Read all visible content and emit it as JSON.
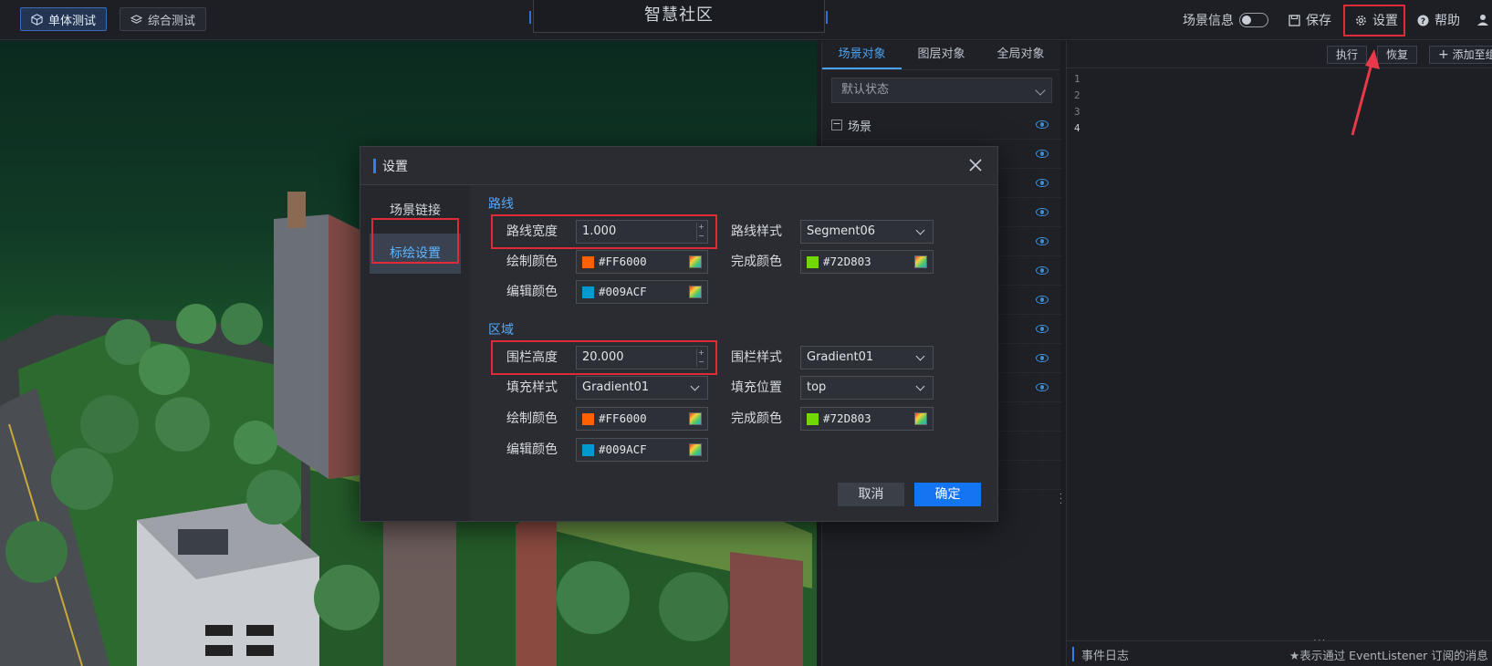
{
  "topbar": {
    "mode_single": "单体测试",
    "mode_combined": "综合测试",
    "title": "智慧社区",
    "scene_info": "场景信息",
    "save": "保存",
    "settings": "设置",
    "help": "帮助"
  },
  "object_panel": {
    "tabs": [
      "场景对象",
      "图层对象",
      "全局对象"
    ],
    "state_select": "默认状态",
    "root_node": "场景"
  },
  "code_panel": {
    "run": "执行",
    "restore": "恢复",
    "add": "添加至组",
    "line_numbers": [
      "1",
      "2",
      "3",
      "4"
    ],
    "event_log_title": "事件日志",
    "event_log_note": "★表示通过 EventListener 订阅的消息"
  },
  "modal": {
    "title": "设置",
    "sidebar": [
      "场景链接",
      "标绘设置"
    ],
    "route_section": "路线",
    "route": {
      "width_label": "路线宽度",
      "width_value": "1.000",
      "style_label": "路线样式",
      "style_value": "Segment06",
      "draw_color_label": "绘制颜色",
      "draw_color": "#FF6000",
      "done_color_label": "完成颜色",
      "done_color": "#72D803",
      "edit_color_label": "编辑颜色",
      "edit_color": "#009ACF"
    },
    "area_section": "区域",
    "area": {
      "fence_height_label": "围栏高度",
      "fence_height_value": "20.000",
      "fence_style_label": "围栏样式",
      "fence_style_value": "Gradient01",
      "fill_style_label": "填充样式",
      "fill_style_value": "Gradient01",
      "fill_pos_label": "填充位置",
      "fill_pos_value": "top",
      "draw_color_label": "绘制颜色",
      "draw_color": "#FF6000",
      "done_color_label": "完成颜色",
      "done_color": "#72D803",
      "edit_color_label": "编辑颜色",
      "edit_color": "#009ACF"
    },
    "cancel": "取消",
    "ok": "确定"
  },
  "colors": {
    "accent": "#1475F2",
    "highlight_box": "#E02A3A",
    "draw": "#FF6000",
    "done": "#72D803",
    "edit": "#009ACF"
  }
}
